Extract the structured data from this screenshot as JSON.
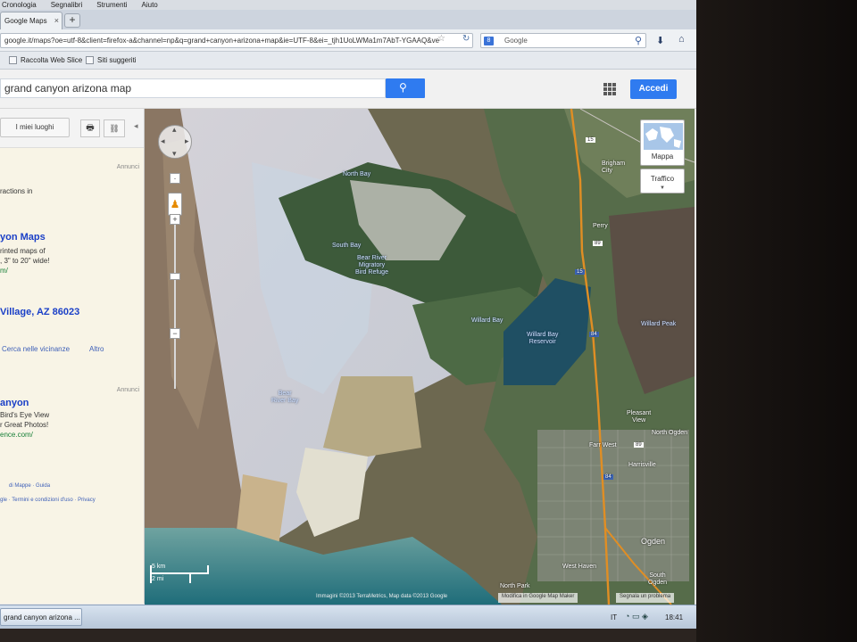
{
  "browser": {
    "menu": [
      "Cronologia",
      "Segnalibri",
      "Strumenti",
      "Aiuto"
    ],
    "tab_title": "Google Maps",
    "tab_close": "×",
    "new_tab": "+",
    "url": "google.it/maps?oe=utf-8&client=firefox-a&channel=np&q=grand+canyon+arizona+map&ie=UTF-8&ei=_tjh1UoLWMa1m7AbT-YGAAQ&ve",
    "search_engine": "Google",
    "bookmarks": [
      "Raccolta Web Slice",
      "Siti suggeriti"
    ]
  },
  "gmaps": {
    "query": "grand canyon arizona map",
    "signin": "Accedi"
  },
  "left_panel": {
    "my_places": "I miei luoghi",
    "ad1_label": "Annunci",
    "snippet1": "ractions in",
    "result1_title": "yon Maps",
    "result1_line1": "rinted maps of",
    "result1_line2": ", 3\" to 20\" wide!",
    "result1_line3": "m/",
    "result2_title": "Village, AZ 86023",
    "nearby": "Cerca nelle vicinanze",
    "more": "Altro",
    "ad2_label": "Annunci",
    "result3_title": "anyon",
    "result3_line1": "Bird's Eye View",
    "result3_line2": "r Great Photos!",
    "result3_url": "ence.com/",
    "footer1": "di Mappe · Guida",
    "footer2": "gle · Termini e condizioni d'uso · Privacy"
  },
  "map": {
    "labels": {
      "north_bay": "North Bay",
      "south_bay": "South Bay",
      "bear_river_refuge": "Bear River\nMigratory\nBird Refuge",
      "willard_bay": "Willard Bay",
      "willard_bay_reservoir": "Willard Bay\nReservoir",
      "willard_peak": "Willard Peak",
      "bear_river_bay": "Bear\nRiver Bay",
      "brigham_city": "Brigham\nCity",
      "perry": "Perry",
      "pleasant_view": "Pleasant\nView",
      "north_ogden": "North Ogden",
      "farr_west": "Farr West",
      "harrisville": "Harrisville",
      "ogden": "Ogden",
      "west_haven": "West Haven",
      "south_ogden": "South\nOgden",
      "north_park": "North Park"
    },
    "highway_shields": [
      "15",
      "84",
      "89",
      "15",
      "84",
      "89"
    ],
    "map_type": "Mappa",
    "traffic": "Traffico",
    "scale_km": "5 km",
    "scale_mi": "2 mi",
    "attribution": "Immagini ©2013 TerraMetrics, Map data ©2013 Google",
    "open_in_maps": "Modifica in Google Map Maker",
    "report": "Segnala un problema"
  },
  "taskbar": {
    "item": "grand canyon arizona ...",
    "lang": "IT",
    "clock": "18:41"
  }
}
